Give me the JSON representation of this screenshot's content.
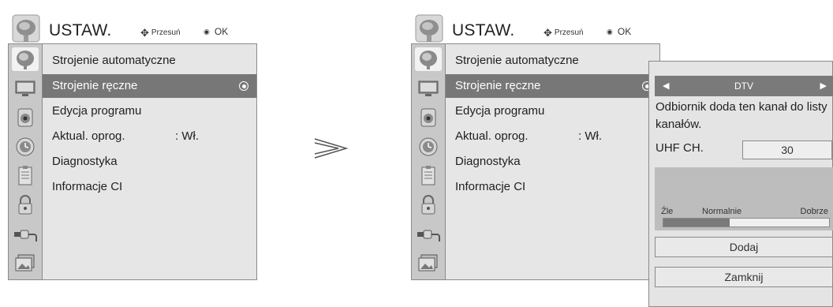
{
  "header": {
    "title": "USTAW.",
    "move_label": "Przesuń",
    "ok_label": "OK"
  },
  "menu_items": [
    {
      "label": "Strojenie automatyczne"
    },
    {
      "label": "Strojenie ręczne"
    },
    {
      "label": "Edycja programu"
    },
    {
      "label": "Aktual. oprog.",
      "value": ": Wł."
    },
    {
      "label": "Diagnostyka"
    },
    {
      "label": "Informacje CI"
    }
  ],
  "selected_index": 1,
  "icons": [
    "satellite-dish-icon",
    "tv-screen-icon",
    "speaker-icon",
    "clock-icon",
    "notepad-icon",
    "lock-icon",
    "connector-icon",
    "photo-icon"
  ],
  "popup": {
    "mode": "DTV",
    "message": "Odbiornik doda ten kanał do listy kanałów.",
    "channel_label": "UHF CH.",
    "channel_value": "30",
    "signal": {
      "bad": "Źle",
      "normal": "Normalnie",
      "good": "Dobrze",
      "level": 0.4
    },
    "add_label": "Dodaj",
    "close_label": "Zamknij"
  },
  "colors": {
    "highlight": "#777777",
    "panel": "#e6e6e6",
    "sidebar": "#c8c8c8"
  }
}
